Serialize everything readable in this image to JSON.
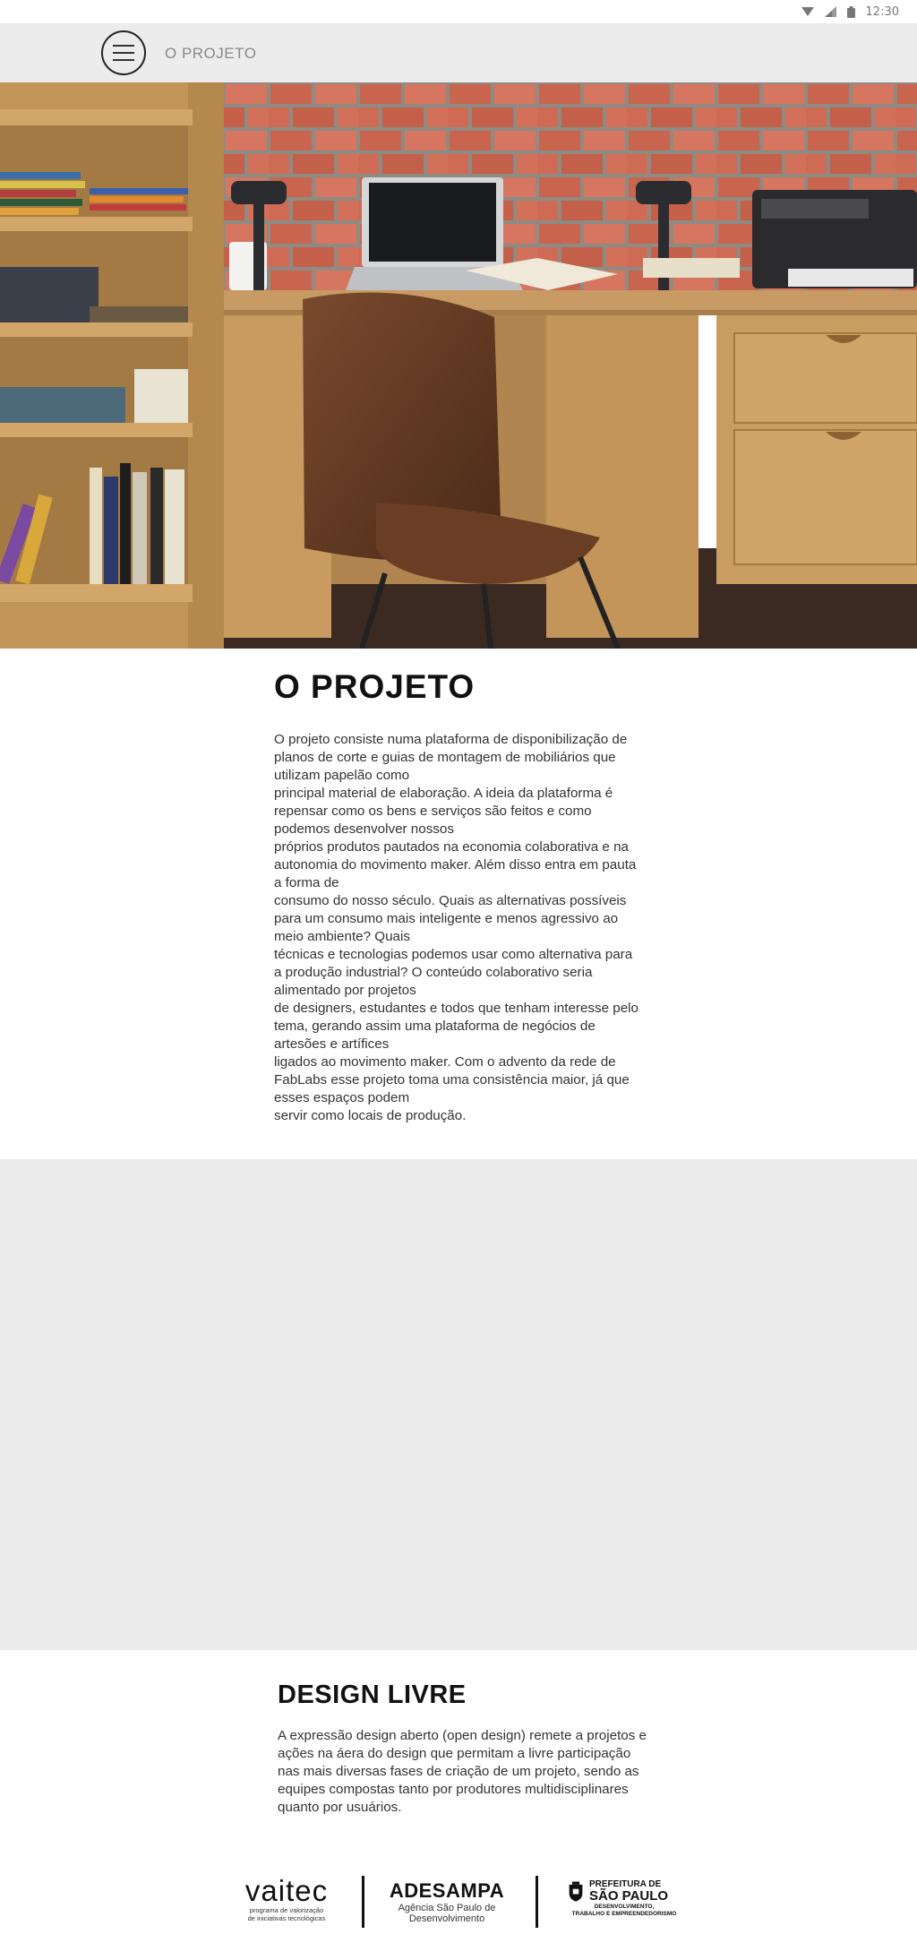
{
  "status_bar": {
    "time": "12:30"
  },
  "app_bar": {
    "title": "O PROJETO"
  },
  "projeto": {
    "title": "O PROJETO",
    "lines": [
      "O projeto consiste numa plataforma de disponibilização de planos de corte e guias de montagem de mobiliários que utilizam papelão como",
      "principal material de elaboração. A ideia da plataforma é repensar como os bens e serviços são feitos e como podemos desenvolver nossos",
      "próprios produtos pautados na economia colaborativa e na autonomia do movimento maker. Além disso entra em pauta a forma de",
      "consumo do nosso século. Quais as alternativas possíveis para um consumo mais inteligente e menos agressivo ao meio ambiente? Quais",
      "técnicas e tecnologias podemos usar como alternativa para a produção industrial? O conteúdo colaborativo seria alimentado por projetos",
      "de designers, estudantes e todos que tenham interesse pelo tema, gerando assim uma plataforma de negócios de artesões e artífices",
      "ligados ao movimento maker. Com o advento da rede de FabLabs esse projeto toma uma consistência maior, já que esses espaços podem",
      "servir como locais de produção."
    ]
  },
  "design_livre": {
    "title": "DESIGN LIVRE",
    "text": "A expressão design aberto (open design) remete a projetos e ações na áera do design que permitam a livre participação nas mais diversas fases de criação de um projeto, sendo as equipes compostas tanto por produtores multidisciplinares quanto por usuários."
  },
  "footer": {
    "vaitec": {
      "name": "vaitec",
      "tagline_1": "programa de valorização",
      "tagline_2": "de iniciativas tecnológicas"
    },
    "adesampa": {
      "name": "ADESAMPA",
      "tagline_1": "Agência São Paulo de",
      "tagline_2": "Desenvolvimento"
    },
    "prefeitura": {
      "line_1": "PREFEITURA DE",
      "line_2": "SÃO PAULO",
      "line_3": "DESENVOLVIMENTO,",
      "line_4": "TRABALHO E EMPREENDEDORISMO"
    }
  }
}
